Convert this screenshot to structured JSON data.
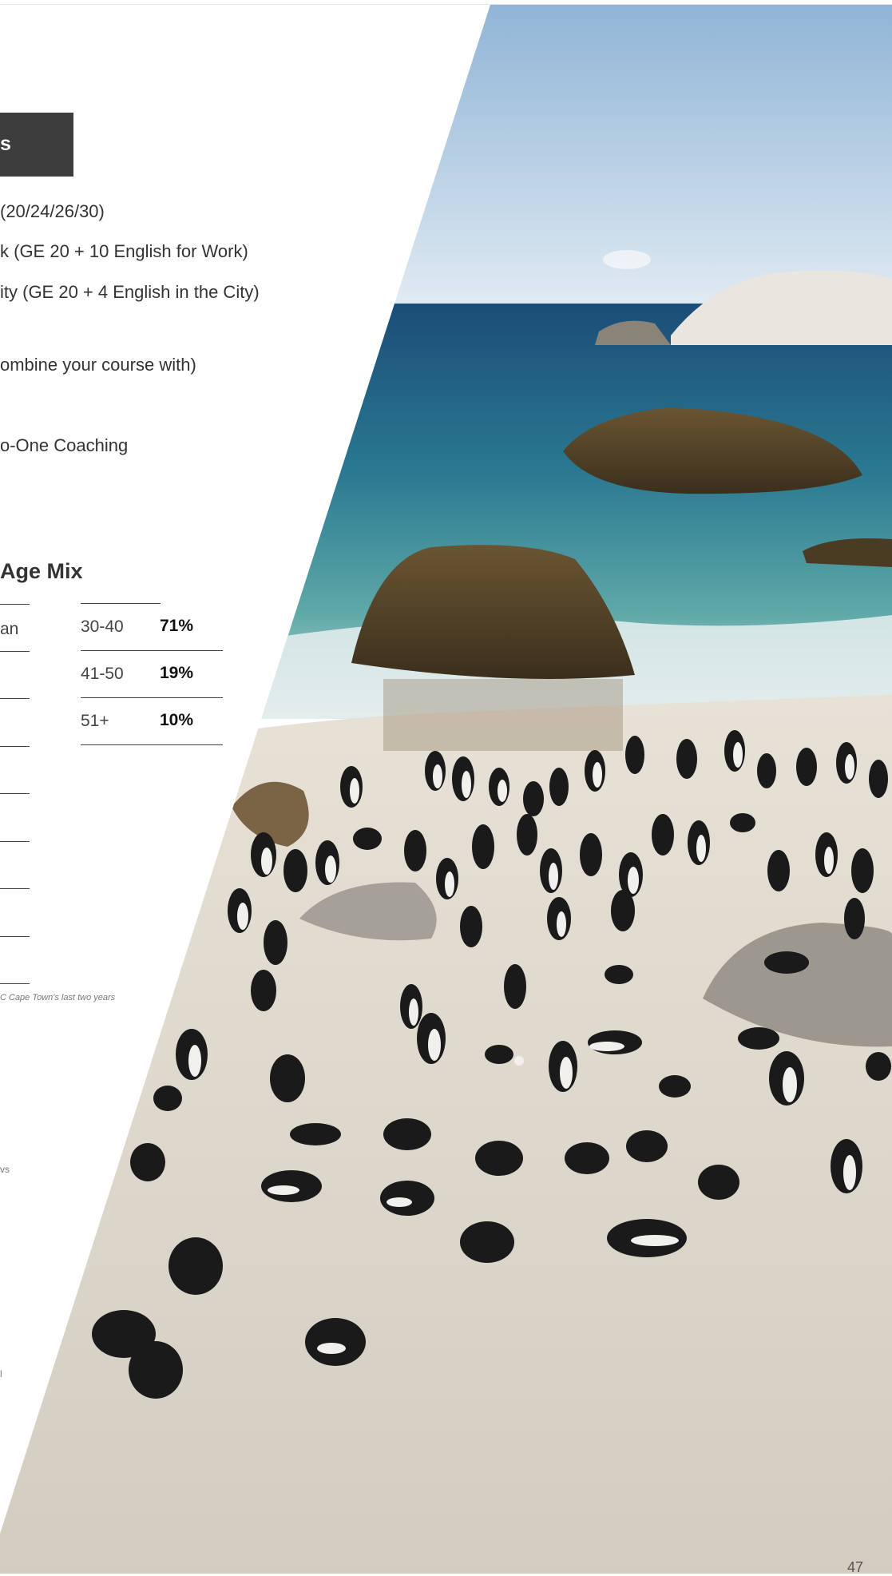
{
  "header_box": {
    "label": "s"
  },
  "course_lines": [
    " (20/24/26/30)",
    "k (GE 20 + 10 English for Work)",
    "ity (GE 20 + 4 English in the City)",
    "ombine your course with)",
    "o-One Coaching"
  ],
  "nationality": {
    "first_entry": "an"
  },
  "age_mix": {
    "heading": "Age Mix",
    "rows": [
      {
        "range": "30-40",
        "percent": "71%"
      },
      {
        "range": "41-50",
        "percent": "19%"
      },
      {
        "range": "51+",
        "percent": "10%"
      }
    ]
  },
  "footnote": "C Cape Town's last two years",
  "stray_fragments": [
    "vs",
    "l"
  ],
  "page_number": "47",
  "photo": {
    "subject": "penguins-on-beach-image"
  }
}
